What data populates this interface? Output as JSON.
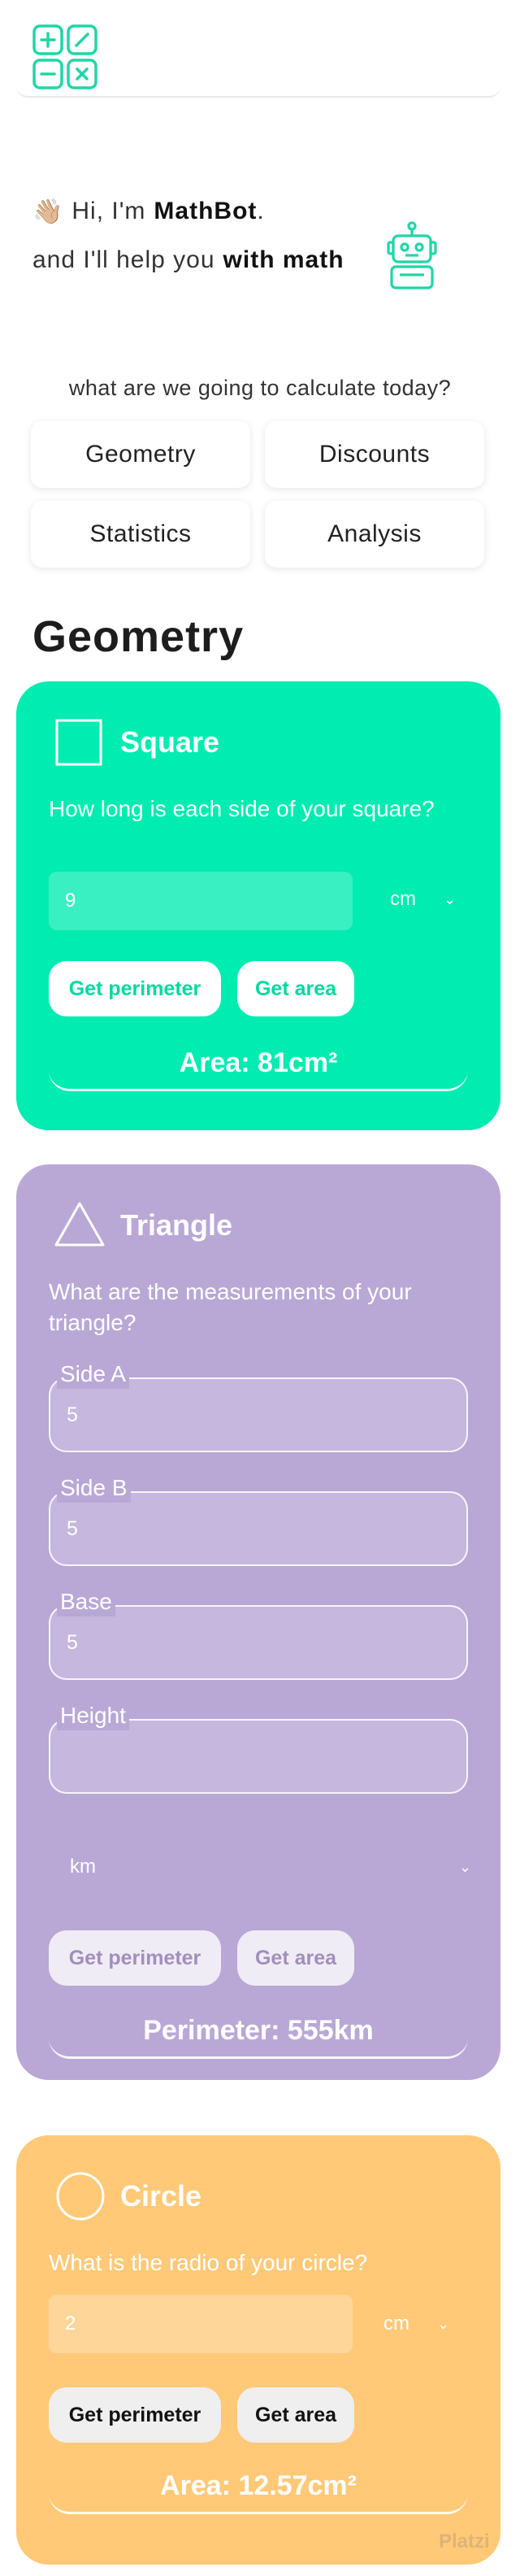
{
  "colors": {
    "geometry_card": "#00ecb0",
    "triangle_card": "#b9a8d6",
    "circle_card": "#ffc978",
    "accent_green": "#00e3a8"
  },
  "header": {
    "logo_icon": "calculator-logo-icon"
  },
  "intro": {
    "wave_emoji": "👋🏼",
    "greeting_prefix": "Hi, I'm",
    "bot_name": "MathBot",
    "greeting_suffix": ".",
    "help_prefix": "and I'll help you",
    "help_emphasis": "with math",
    "robot_icon": "robot-icon"
  },
  "question": "what are we going to calculate today?",
  "topics": [
    "Geometry",
    "Discounts",
    "Statistics",
    "Analysis"
  ],
  "section_title": "Geometry",
  "square": {
    "title": "Square",
    "question": "How long is each side of your square?",
    "value": "9",
    "unit": "cm",
    "perimeter_label": "Get perimeter",
    "area_label": "Get area",
    "result": "Area: 81cm²"
  },
  "triangle": {
    "title": "Triangle",
    "question": "What are the measurements of your triangle?",
    "fields": [
      {
        "label": "Side A",
        "value": "5"
      },
      {
        "label": "Side B",
        "value": "5"
      },
      {
        "label": "Base",
        "value": "5"
      },
      {
        "label": "Height",
        "value": ""
      }
    ],
    "unit": "km",
    "perimeter_label": "Get perimeter",
    "area_label": "Get area",
    "result": "Perimeter: 555km"
  },
  "circle": {
    "title": "Circle",
    "question": "What is the radio of your circle?",
    "value": "2",
    "unit": "cm",
    "perimeter_label": "Get perimeter",
    "area_label": "Get area",
    "result": "Area: 12.57cm²"
  },
  "watermark": "Platzi"
}
